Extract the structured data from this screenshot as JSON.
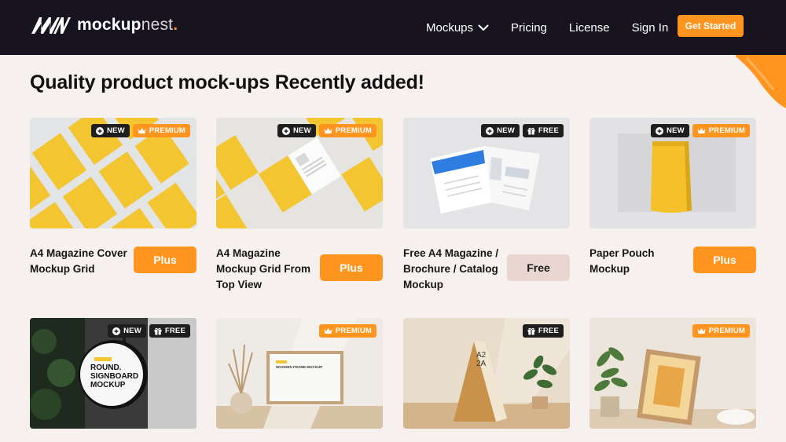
{
  "brand": {
    "logo_bold": "mockup",
    "logo_light": "nest",
    "logo_dot": "."
  },
  "nav": {
    "items": [
      "Mockups",
      "Pricing",
      "License",
      "Sign In"
    ],
    "cta": "Get Started"
  },
  "heading": "Quality product mock-ups Recently added!",
  "badge_labels": {
    "new": "NEW",
    "premium": "PREMIUM",
    "free": "FREE"
  },
  "cards": [
    {
      "title": "A4 Magazine Cover Mockup Grid",
      "price": "Plus",
      "badges": [
        "new",
        "premium"
      ]
    },
    {
      "title": "A4 Magazine Mockup Grid From Top View",
      "price": "Plus",
      "badges": [
        "new",
        "premium"
      ]
    },
    {
      "title": "Free A4 Magazine / Brochure / Catalog Mockup",
      "price": "Free",
      "badges": [
        "new",
        "free"
      ]
    },
    {
      "title": "Paper Pouch Mockup",
      "price": "Plus",
      "badges": [
        "new",
        "premium"
      ]
    },
    {
      "title": "",
      "price": "",
      "badges": [
        "new",
        "free"
      ]
    },
    {
      "title": "",
      "price": "",
      "badges": [
        "premium"
      ]
    },
    {
      "title": "",
      "price": "",
      "badges": [
        "free"
      ]
    },
    {
      "title": "",
      "price": "",
      "badges": [
        "premium"
      ]
    }
  ],
  "thumb_texts": {
    "signboard": [
      "ROUND.",
      "SIGNBOARD",
      "MOCKUP"
    ],
    "a2": "A2\n2A",
    "frame": "WOODEN FRAME MOCKUP"
  },
  "colors": {
    "accent": "#ff951f",
    "nav_bg": "#17141f",
    "page_bg": "#f6f1ef",
    "free_btn": "#ead6d0"
  }
}
